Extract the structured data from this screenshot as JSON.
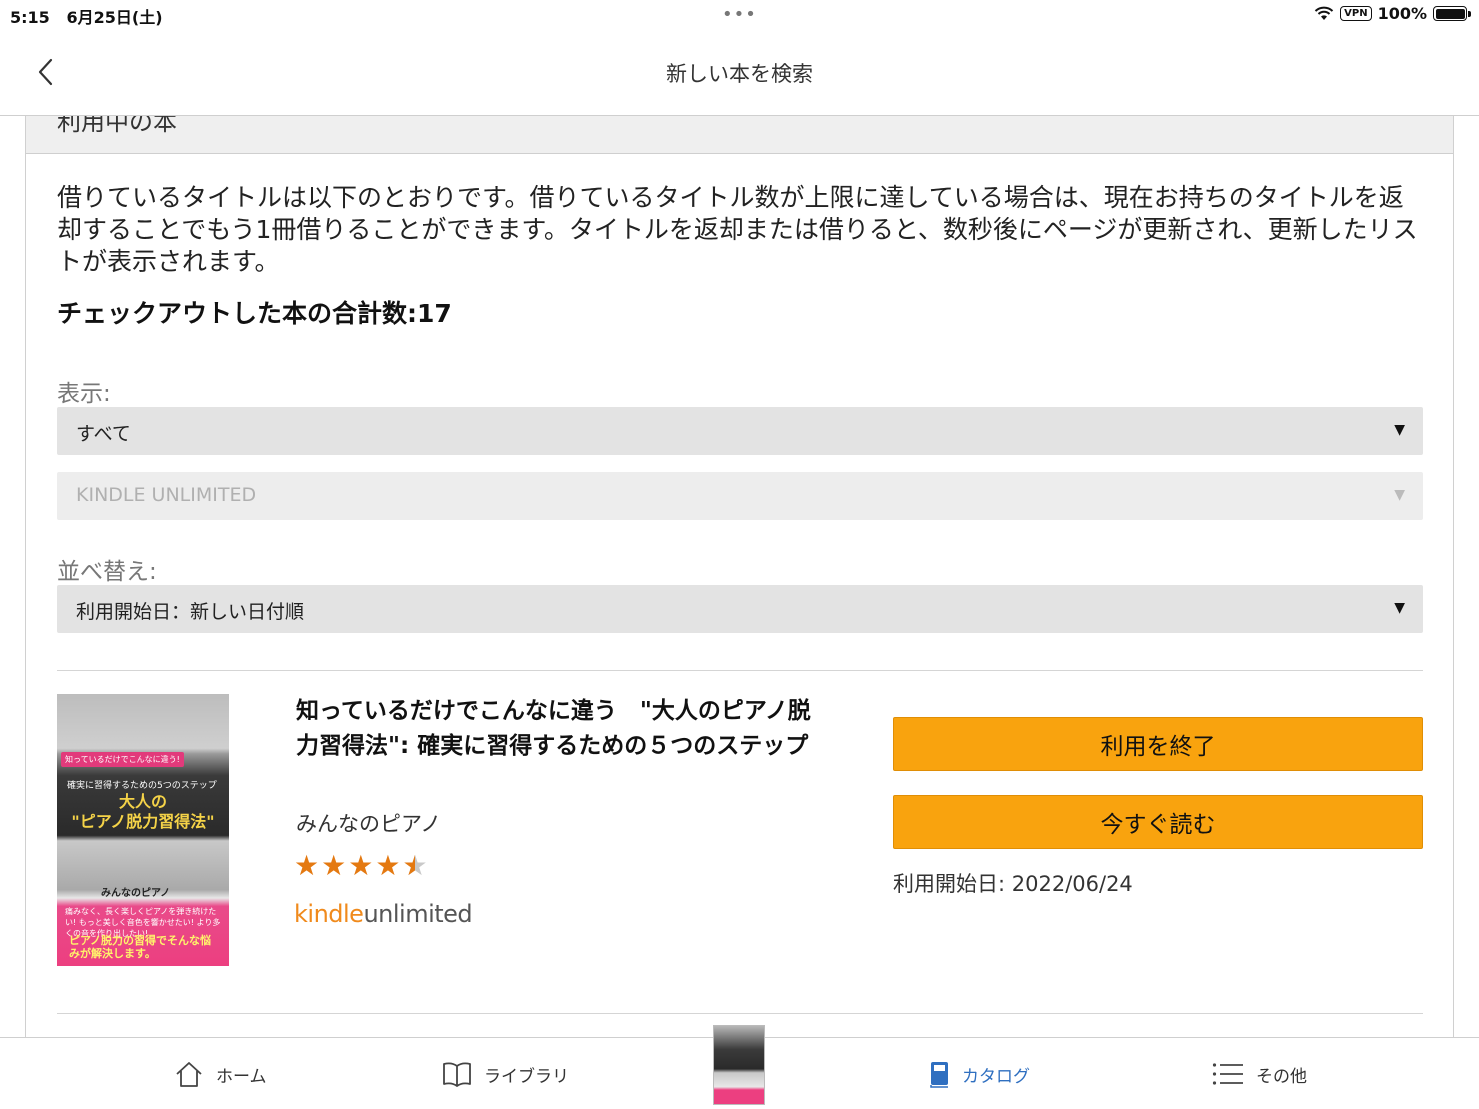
{
  "status_bar": {
    "time": "5:15",
    "date": "6月25日(土)",
    "dots": "•••",
    "vpn": "VPN",
    "battery": "100%"
  },
  "nav": {
    "title": "新しい本を検索"
  },
  "section": {
    "title": "利用中の本"
  },
  "description": "借りているタイトルは以下のとおりです。借りているタイトル数が上限に達している場合は、現在お持ちのタイトルを返却することでもう1冊借りることができます。タイトルを返却または借りると、数秒後にページが更新され、更新したリストが表示されます。",
  "checkout_total": "チェックアウトした本の合計数:17",
  "filters": {
    "display_label": "表示:",
    "display_value": "すべて",
    "program_value": "KINDLE UNLIMITED",
    "sort_label": "並べ替え:",
    "sort_value": "利用開始日：新しい日付順"
  },
  "book": {
    "title": "知っているだけでこんなに違う　\"大人のピアノ脱力習得法\": 確実に習得するための５つのステップ",
    "author": "みんなのピアノ",
    "rating": 4.5,
    "rating_max": 5,
    "badge_kindle": "kindle",
    "badge_unlimited": "unlimited",
    "return_button": "利用を終了",
    "read_button": "今すぐ読む",
    "start_date": "利用開始日: 2022/06/24",
    "cover": {
      "tag": "知っているだけでこんなに違う!",
      "subtitle": "確実に習得するための5つのステップ",
      "title_line1": "大人の",
      "title_line2": "\"ピアノ脱力習得法\"",
      "brand": "みんなのピアノ",
      "bullets": "痛みなく、長く楽しくピアノを弾き続けたい! もっと美しく音色を響かせたい! より多くの音を作り出したい!",
      "closing": "ピアノ脱力の習得でそんな悩みが解決します。"
    }
  },
  "tabs": {
    "home": "ホーム",
    "library": "ライブラリ",
    "catalog": "カタログ",
    "more": "その他"
  },
  "colors": {
    "button": "#f9a30e",
    "active_tab": "#2f6fc0",
    "star": "#e47911"
  }
}
